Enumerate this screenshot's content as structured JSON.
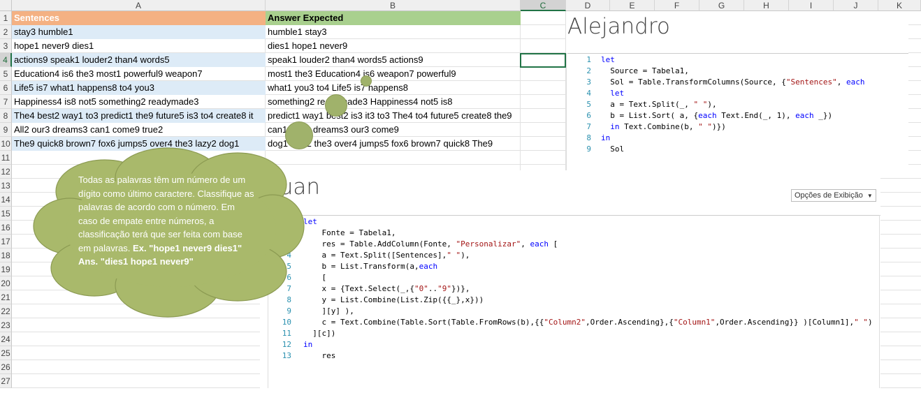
{
  "columns": [
    {
      "letter": "A"
    },
    {
      "letter": "B"
    },
    {
      "letter": "C"
    },
    {
      "letter": "D"
    },
    {
      "letter": "E"
    },
    {
      "letter": "F"
    },
    {
      "letter": "G"
    },
    {
      "letter": "H"
    },
    {
      "letter": "I"
    },
    {
      "letter": "J"
    },
    {
      "letter": "K"
    }
  ],
  "rows": [
    "1",
    "2",
    "3",
    "4",
    "5",
    "6",
    "7",
    "8",
    "9",
    "10",
    "11",
    "12",
    "13",
    "14",
    "15",
    "16",
    "17",
    "18",
    "19",
    "20",
    "21",
    "22",
    "23",
    "24",
    "25",
    "26",
    "27"
  ],
  "table": {
    "header_a": "Sentences",
    "header_b": "Answer Expected",
    "filter_icon": "filter-dropdown-icon",
    "rows": [
      {
        "a": "stay3 humble1",
        "b": "humble1 stay3"
      },
      {
        "a": "hope1 never9 dies1",
        "b": "dies1 hope1 never9"
      },
      {
        "a": "actions9 speak1 louder2 than4 words5",
        "b": "speak1 louder2 than4 words5 actions9"
      },
      {
        "a": "Education4 is6 the3 most1 powerful9 weapon7",
        "b": "most1 the3 Education4 is6 weapon7 powerful9"
      },
      {
        "a": "Life5 is7 what1 happens8 to4 you3",
        "b": "what1 you3 to4 Life5 is7 happens8"
      },
      {
        "a": "Happiness4 is8 not5 something2 readymade3",
        "b": "something2 readymade3 Happiness4 not5 is8"
      },
      {
        "a": "The4 best2 way1 to3 predict1 the9 future5 is3 to4 create8 it",
        "b": "predict1 way1 best2 is3 it3 to3 The4 to4 future5 create8 the9"
      },
      {
        "a": "All2 our3 dreams3 can1 come9 true2",
        "b": "can1 true2 dreams3 our3 come9"
      },
      {
        "a": "The9 quick8 brown7 fox6 jumps5 over4 the3 lazy2 dog1",
        "b": "dog1 lazy2 the3 over4 jumps5 fox6 brown7 quick8 The9"
      }
    ]
  },
  "cloud": {
    "text": "Todas as palavras têm um número de um dígito como último caractere. Classifique as palavras de acordo com o número. Em caso de empate entre números, a classificação terá que ser feita com base em palavras.",
    "bold": "Ex. \"hope1 never9 dies1\" Ans. \"dies1 hope1 never9\"",
    "color": "#a9b96b"
  },
  "alejandro": {
    "title": "Alejandro",
    "lines": [
      {
        "n": "1",
        "t": "let"
      },
      {
        "n": "2",
        "t": "  Source = Tabela1,"
      },
      {
        "n": "3",
        "t": "  Sol = Table.TransformColumns(Source, {\"Sentences\", each"
      },
      {
        "n": "4",
        "t": "  let"
      },
      {
        "n": "5",
        "t": "  a = Text.Split(_, \" \"),"
      },
      {
        "n": "6",
        "t": "  b = List.Sort( a, {each Text.End(_, 1), each _})"
      },
      {
        "n": "7",
        "t": "  in Text.Combine(b, \" \")})"
      },
      {
        "n": "8",
        "t": "in"
      },
      {
        "n": "9",
        "t": "  Sol"
      }
    ]
  },
  "luan": {
    "title": "Luan",
    "options_label": "Opções de Exibição",
    "lines": [
      {
        "n": "1",
        "t": "let"
      },
      {
        "n": "2",
        "t": "    Fonte = Tabela1,"
      },
      {
        "n": "3",
        "t": "    res = Table.AddColumn(Fonte, \"Personalizar\", each ["
      },
      {
        "n": "4",
        "t": "    a = Text.Split([Sentences],\" \"),"
      },
      {
        "n": "5",
        "t": "    b = List.Transform(a,each"
      },
      {
        "n": "6",
        "t": "    ["
      },
      {
        "n": "7",
        "t": "    x = {Text.Select(_,{\"0\"..\"9\"})},"
      },
      {
        "n": "8",
        "t": "    y = List.Combine(List.Zip({{_},x}))"
      },
      {
        "n": "9",
        "t": "    ][y] ),"
      },
      {
        "n": "10",
        "t": "    c = Text.Combine(Table.Sort(Table.FromRows(b),{{\"Column2\",Order.Ascending},{\"Column1\",Order.Ascending}} )[Column1],\" \")"
      },
      {
        "n": "11",
        "t": "  ][c])"
      },
      {
        "n": "12",
        "t": "in"
      },
      {
        "n": "13",
        "t": "    res"
      }
    ]
  },
  "colors": {
    "header_a": "#f4b183",
    "header_b": "#a9d08e",
    "band": "#ddebf7",
    "selection": "#217346"
  }
}
